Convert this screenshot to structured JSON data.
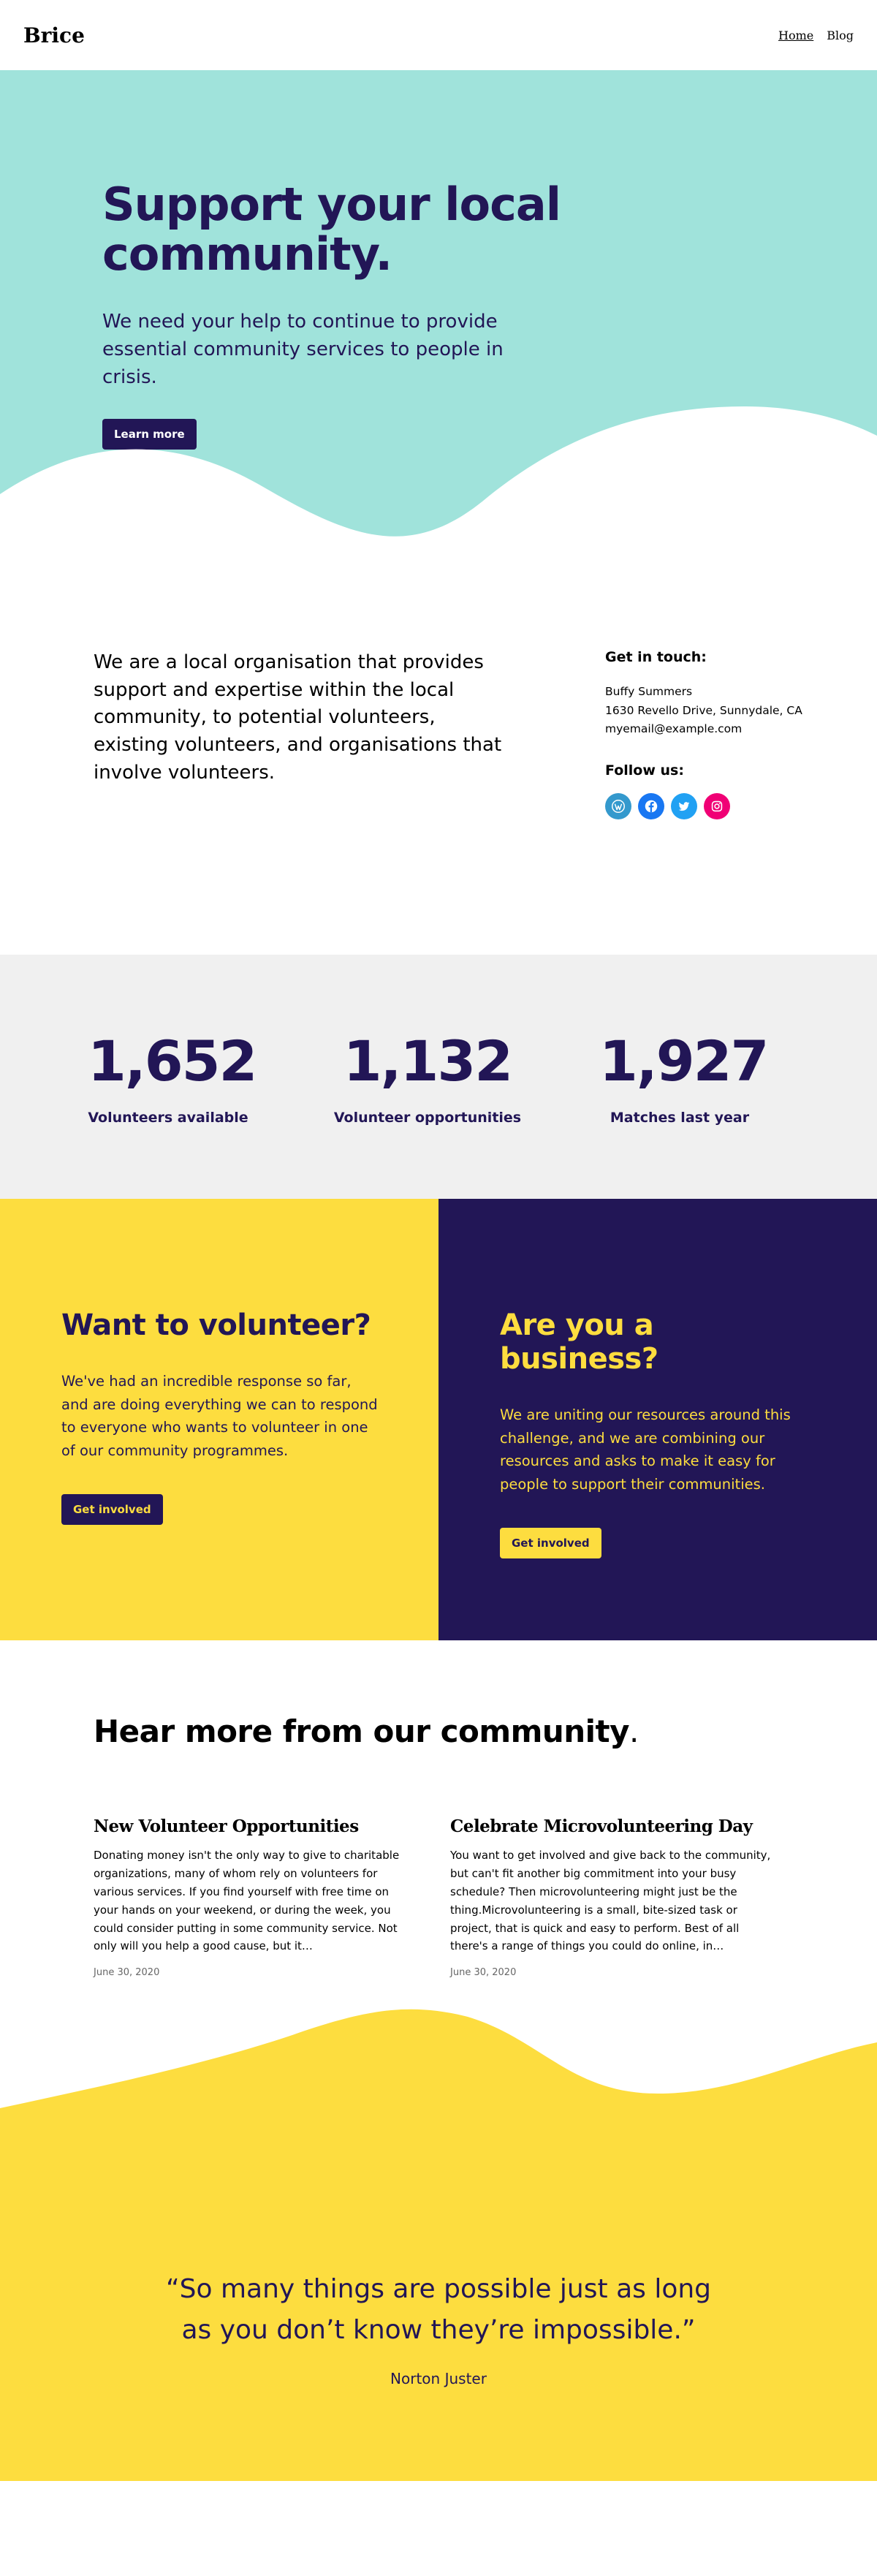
{
  "header": {
    "logo": "Brice",
    "nav": [
      {
        "label": "Home",
        "active": true
      },
      {
        "label": "Blog",
        "active": false
      }
    ]
  },
  "hero": {
    "title": "Support your local community.",
    "text": "We need your help to continue to provide essential community services to people in crisis.",
    "button": "Learn more"
  },
  "about": {
    "text": "We are a local organisation that provides support and expertise within the local community, to potential volunteers, existing volunteers, and organisations that involve volunteers.",
    "contact_heading": "Get in touch:",
    "contact_name": "Buffy Summers",
    "contact_address": "1630 Revello Drive, Sunnydale, CA",
    "contact_email": "myemail@example.com",
    "follow_heading": "Follow us:",
    "socials": [
      {
        "icon": "wordpress-icon",
        "color": "#3499cd"
      },
      {
        "icon": "facebook-icon",
        "color": "#1977f2"
      },
      {
        "icon": "twitter-icon",
        "color": "#21a1f3"
      },
      {
        "icon": "instagram-icon",
        "color": "#f00075"
      }
    ]
  },
  "stats": [
    {
      "value": "1,652",
      "label": "Volunteers available"
    },
    {
      "value": "1,132",
      "label": "Volunteer opportunities"
    },
    {
      "value": "1,927",
      "label": "Matches last year"
    }
  ],
  "volunteer": {
    "title": "Want to volunteer?",
    "text": "We've had an incredible response so far, and are doing everything we can to respond to everyone who wants to volunteer in one of our community programmes.",
    "button": "Get involved"
  },
  "business": {
    "title": "Are you a business?",
    "text": "We are uniting our resources around this challenge, and we are combining our resources and asks to make it easy for people to support their communities.",
    "button": "Get involved"
  },
  "community": {
    "title": "Hear more from our community",
    "title_dot": ".",
    "posts": [
      {
        "title": "New Volunteer Opportunities",
        "excerpt": "Donating money isn't the only way to give to charitable organizations, many of whom rely on volunteers for various services. If you find yourself with free time on your hands on your weekend, or during the week, you could consider putting in some community service. Not only will you help a good cause, but it…",
        "date": "June 30, 2020"
      },
      {
        "title": "Celebrate Microvolunteering Day",
        "excerpt": "You want to get involved and give back to the community, but can't fit another big commitment into your busy schedule? Then microvolunteering might just be the thing.Microvolunteering is a small, bite-sized task or project, that is quick and easy to perform. Best of all there's a range of things you could do online, in…",
        "date": "June 30, 2020"
      }
    ]
  },
  "quote": {
    "text": "“So many things are possible just as long as you don’t know they’re impossible.”",
    "author": "Norton Juster"
  },
  "colors": {
    "navy": "#221656",
    "teal": "#a0e3db",
    "yellow": "#fddd3f",
    "light_gray": "#f0f0f0"
  }
}
